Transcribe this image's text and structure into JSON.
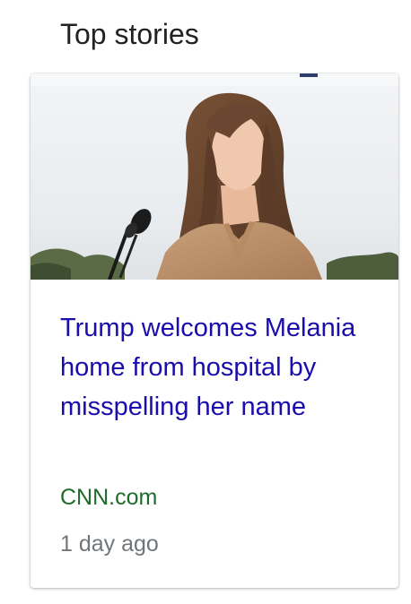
{
  "section": {
    "title": "Top stories"
  },
  "story": {
    "headline": "Trump welcomes Melania home from hospital by misspelling her name",
    "source": "CNN.com",
    "time": "1 day ago",
    "image": "news-photo"
  },
  "colors": {
    "headline": "#1a0dab",
    "source": "#1e6b2a",
    "time": "#70757a",
    "title": "#222222"
  }
}
